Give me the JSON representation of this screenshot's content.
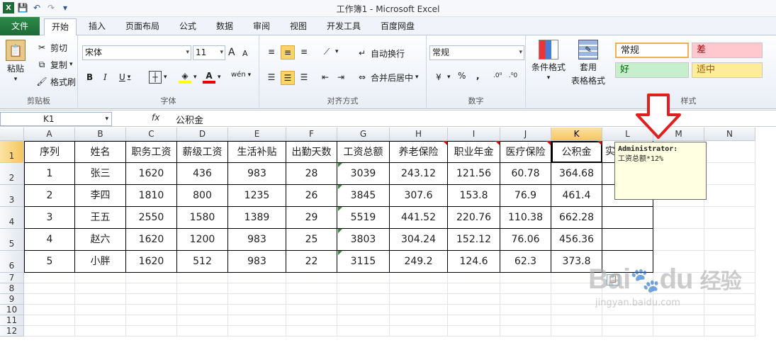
{
  "window": {
    "title": "工作簿1 - Microsoft Excel"
  },
  "qat": {
    "save": "💾",
    "undo": "↶",
    "redo": "↷",
    "more": "▾"
  },
  "tabs": [
    "文件",
    "开始",
    "插入",
    "页面布局",
    "公式",
    "数据",
    "审阅",
    "视图",
    "开发工具",
    "百度网盘"
  ],
  "ribbon": {
    "clipboard": {
      "label": "剪贴板",
      "paste": "粘贴",
      "cut": "剪切",
      "copy": "复制",
      "format_painter": "格式刷"
    },
    "font": {
      "label": "字体",
      "name": "宋体",
      "size": "11",
      "bold": "B",
      "italic": "I",
      "underline": "U",
      "grow": "A",
      "shrink": "A",
      "phonetic": "wén"
    },
    "alignment": {
      "label": "对齐方式",
      "wrap": "自动换行",
      "merge": "合并后居中"
    },
    "number": {
      "label": "数字",
      "format": "常规",
      "percent": "%",
      "comma": ","
    },
    "styles": {
      "label": "样式",
      "conditional": "条件格式",
      "table_line1": "套用",
      "table_line2": "表格格式",
      "normal": "常规",
      "bad": "差",
      "good": "好",
      "neutral": "适中"
    }
  },
  "formula_bar": {
    "name_box": "K1",
    "fx": "fx",
    "value": "公积金"
  },
  "columns": [
    "A",
    "B",
    "C",
    "D",
    "E",
    "F",
    "G",
    "H",
    "I",
    "J",
    "K",
    "L",
    "M",
    "N"
  ],
  "rows": [
    "1",
    "2",
    "3",
    "4",
    "5",
    "6",
    "7",
    "8",
    "9",
    "10",
    "11",
    "12"
  ],
  "table": {
    "headers": [
      "序列",
      "姓名",
      "职务工资",
      "薪级工资",
      "生活补贴",
      "出勤天数",
      "工资总额",
      "养老保险",
      "职业年金",
      "医疗保险",
      "公积金",
      "实"
    ],
    "data": [
      [
        "1",
        "张三",
        "1620",
        "436",
        "983",
        "28",
        "3039",
        "243.12",
        "121.56",
        "60.78",
        "364.68"
      ],
      [
        "2",
        "李四",
        "1810",
        "800",
        "1235",
        "26",
        "3845",
        "307.6",
        "153.8",
        "76.9",
        "461.4"
      ],
      [
        "3",
        "王五",
        "2550",
        "1580",
        "1389",
        "29",
        "5519",
        "441.52",
        "220.76",
        "110.38",
        "662.28"
      ],
      [
        "4",
        "赵六",
        "1620",
        "1200",
        "983",
        "25",
        "3803",
        "304.24",
        "152.12",
        "76.06",
        "456.36"
      ],
      [
        "5",
        "小胖",
        "1620",
        "512",
        "983",
        "22",
        "3115",
        "249.2",
        "124.6",
        "62.3",
        "373.8"
      ]
    ]
  },
  "comment": {
    "author": "Administrator:",
    "text": "工资总额*12%"
  },
  "watermark": {
    "brand": "Bai",
    "brand2": "du",
    "cn": "经验",
    "url": "jingyan.baidu.com"
  },
  "colors": {
    "accent_green": "#1d6b37",
    "arrow_red": "#e02020",
    "comment_bg": "#ffffe1"
  }
}
